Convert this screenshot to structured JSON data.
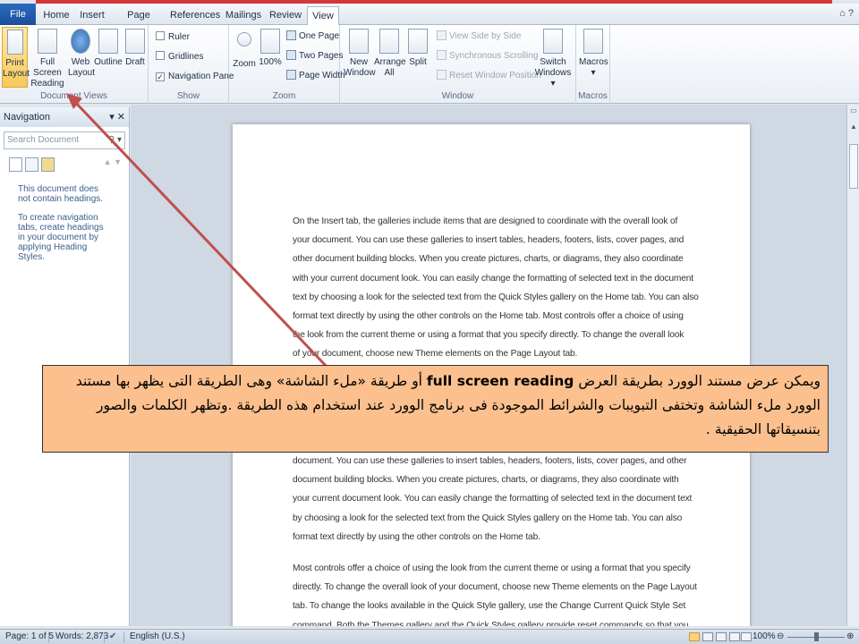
{
  "ribbon_tabs": [
    "File",
    "Home",
    "Insert",
    "Page Layout",
    "References",
    "Mailings",
    "Review",
    "View"
  ],
  "active_tab": "View",
  "groups": {
    "document_views": {
      "label": "Document Views",
      "buttons": [
        {
          "line1": "Print",
          "line2": "Layout"
        },
        {
          "line1": "Full Screen",
          "line2": "Reading"
        },
        {
          "line1": "Web",
          "line2": "Layout"
        },
        {
          "line1": "Outline",
          "line2": ""
        },
        {
          "line1": "Draft",
          "line2": ""
        }
      ]
    },
    "show": {
      "label": "Show",
      "items": [
        {
          "label": "Ruler",
          "checked": false
        },
        {
          "label": "Gridlines",
          "checked": false
        },
        {
          "label": "Navigation Pane",
          "checked": true
        }
      ]
    },
    "zoom": {
      "label": "Zoom",
      "zoom_label": "Zoom",
      "hundred_label": "100%",
      "one_page": "One Page",
      "two_pages": "Two Pages",
      "page_width": "Page Width"
    },
    "window": {
      "label": "Window",
      "new_window": {
        "line1": "New",
        "line2": "Window"
      },
      "arrange_all": {
        "line1": "Arrange",
        "line2": "All"
      },
      "split": "Split",
      "side_by_side": "View Side by Side",
      "sync_scroll": "Synchronous Scrolling",
      "reset_position": "Reset Window Position",
      "switch_windows": {
        "line1": "Switch",
        "line2": "Windows ▾"
      }
    },
    "macros": {
      "label": "Macros",
      "button": "Macros"
    }
  },
  "navigation": {
    "title": "Navigation",
    "search_placeholder": "Search Document",
    "no_headings": "This document does not contain headings.",
    "hint": "To create navigation tabs, create headings in your document by applying Heading Styles."
  },
  "document": {
    "para1_lines": [
      "On the Insert tab, the galleries include items that are designed to coordinate with the overall look of",
      "your document. You can use these galleries to insert tables, headers, footers, lists, cover pages, and",
      "other document building blocks. When you create pictures, charts, or diagrams, they also coordinate",
      "with your current document look. You can easily change the formatting of selected text in the document",
      "text by choosing a look for the selected text from the Quick Styles gallery on the Home tab. You can also",
      "format text directly by using the other controls on the Home tab. Most controls offer a choice of using",
      "the look from the current theme or using a format that you specify directly. To change the overall look",
      "of your document, choose new Theme elements on the Page Layout tab."
    ],
    "para2_lines": [
      "document. You can use these galleries to insert tables, headers, footers, lists, cover pages, and other",
      "document building blocks. When you create pictures, charts, or diagrams, they also coordinate with",
      "your current document look. You can easily change the formatting of selected text in the document text",
      "by choosing a look for the selected text from the Quick Styles gallery on the Home tab. You can also",
      "format text directly by using the other controls on the Home tab."
    ],
    "para3_lines": [
      "Most controls offer a choice of using the look from the current theme or using a format that you specify",
      "directly. To change the overall look of your document, choose new Theme elements on the Page Layout",
      "tab. To change the looks available in the Quick Style gallery, use the Change Current Quick Style Set",
      "command. Both the Themes gallery and the Quick Styles gallery provide reset commands so that you"
    ]
  },
  "callout": {
    "prefix": "ويمكن عرض مستند الوورد بطريقة العرض",
    "bold": "full screen reading",
    "suffix": "أو طريقة «ملء الشاشة» وهى الطريقة التى يظهر بها مستند الوورد ملء الشاشة وتختفى التبويبات والشرائط الموجودة فى برنامج الوورد عند استخدام هذه الطريقة .وتظهر الكلمات والصور بتنسيقاتها الحقيقية ."
  },
  "status": {
    "page": "Page: 1 of 5",
    "words": "Words: 2,873",
    "language": "English (U.S.)",
    "zoom": "100%"
  },
  "colors": {
    "callout_bg": "#fbc08d",
    "arrow": "#c0504d",
    "file_tab": "#2a62b4"
  }
}
